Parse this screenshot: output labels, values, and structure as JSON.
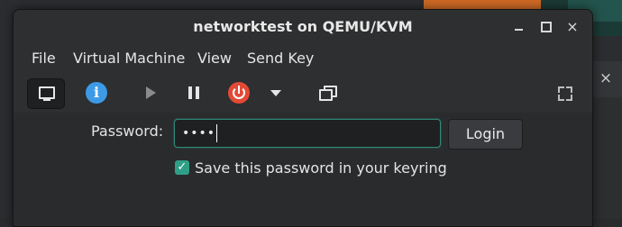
{
  "window": {
    "title": "networktest on QEMU/KVM"
  },
  "titlebar_buttons": {
    "minimize_icon": "minimize-icon",
    "maximize_icon": "maximize-icon",
    "close_glyph": "×"
  },
  "menubar": {
    "items": [
      {
        "label": "File"
      },
      {
        "label": "Virtual Machine"
      },
      {
        "label": "View"
      },
      {
        "label": "Send Key"
      }
    ]
  },
  "toolbar": {
    "info_glyph": "i",
    "icons": [
      "monitor-icon",
      "info-icon",
      "play-icon",
      "pause-icon",
      "power-icon",
      "chevron-down-icon",
      "snapshot-icon",
      "fullscreen-icon"
    ]
  },
  "login": {
    "password_label": "Password:",
    "password_value": "••••",
    "login_button": "Login",
    "save_checkbox_label": "Save this password in your keyring",
    "save_checkbox_checked": true,
    "check_glyph": "✓"
  },
  "background_window": {
    "close_glyph": "×"
  },
  "colors": {
    "accent": "#2f9f87",
    "info": "#3d9ae6",
    "power": "#e34a36",
    "window_bg": "#2e2f31"
  }
}
